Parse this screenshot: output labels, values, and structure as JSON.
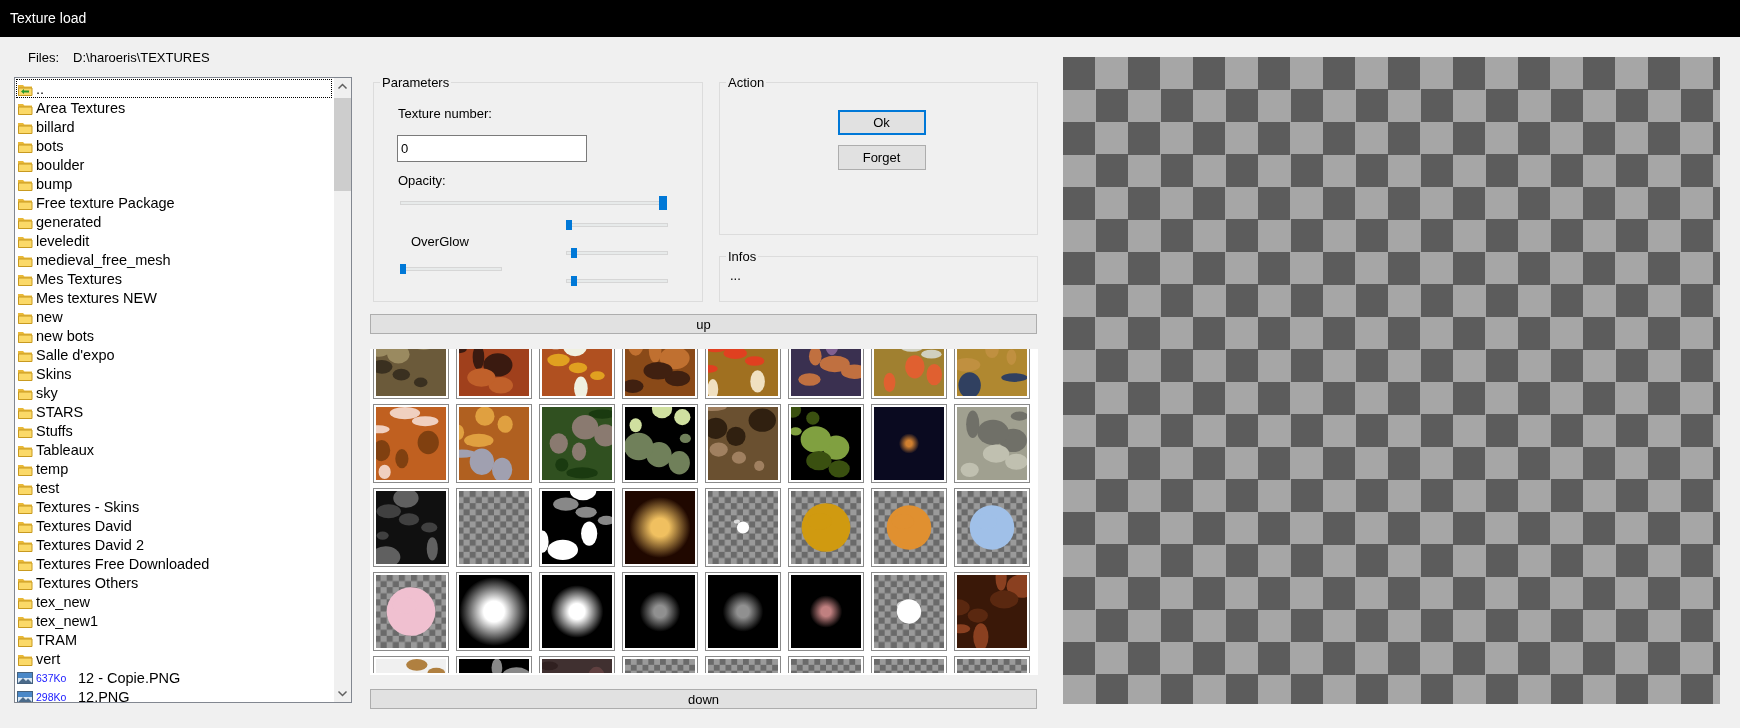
{
  "window": {
    "title": "Texture load"
  },
  "files": {
    "label": "Files:",
    "path": "D:\\haroeris\\TEXTURES",
    "items": [
      {
        "kind": "parent",
        "name": "..",
        "selected": true
      },
      {
        "kind": "folder",
        "name": "Area Textures",
        "selected": false
      },
      {
        "kind": "folder",
        "name": "billard",
        "selected": false
      },
      {
        "kind": "folder",
        "name": "bots",
        "selected": false
      },
      {
        "kind": "folder",
        "name": "boulder",
        "selected": false
      },
      {
        "kind": "folder",
        "name": "bump",
        "selected": false
      },
      {
        "kind": "folder",
        "name": "Free texture Package",
        "selected": false
      },
      {
        "kind": "folder",
        "name": "generated",
        "selected": false
      },
      {
        "kind": "folder",
        "name": "leveledit",
        "selected": false
      },
      {
        "kind": "folder",
        "name": "medieval_free_mesh",
        "selected": false
      },
      {
        "kind": "folder",
        "name": "Mes Textures",
        "selected": false
      },
      {
        "kind": "folder",
        "name": "Mes textures NEW",
        "selected": false
      },
      {
        "kind": "folder",
        "name": "new",
        "selected": false
      },
      {
        "kind": "folder",
        "name": "new bots",
        "selected": false
      },
      {
        "kind": "folder",
        "name": "Salle d'expo",
        "selected": false
      },
      {
        "kind": "folder",
        "name": "Skins",
        "selected": false
      },
      {
        "kind": "folder",
        "name": "sky",
        "selected": false
      },
      {
        "kind": "folder",
        "name": "STARS",
        "selected": false
      },
      {
        "kind": "folder",
        "name": "Stuffs",
        "selected": false
      },
      {
        "kind": "folder",
        "name": "Tableaux",
        "selected": false
      },
      {
        "kind": "folder",
        "name": "temp",
        "selected": false
      },
      {
        "kind": "folder",
        "name": "test",
        "selected": false
      },
      {
        "kind": "folder",
        "name": "Textures - Skins",
        "selected": false
      },
      {
        "kind": "folder",
        "name": "Textures David",
        "selected": false
      },
      {
        "kind": "folder",
        "name": "Textures David 2",
        "selected": false
      },
      {
        "kind": "folder",
        "name": "Textures Free Downloaded",
        "selected": false
      },
      {
        "kind": "folder",
        "name": "Textures Others",
        "selected": false
      },
      {
        "kind": "folder",
        "name": "tex_new",
        "selected": false
      },
      {
        "kind": "folder",
        "name": "tex_new1",
        "selected": false
      },
      {
        "kind": "folder",
        "name": "TRAM",
        "selected": false
      },
      {
        "kind": "folder",
        "name": "vert",
        "selected": false
      },
      {
        "kind": "file",
        "size": "637Ko",
        "name": "12 - Copie.PNG",
        "selected": false
      },
      {
        "kind": "file",
        "size": "298Ko",
        "name": "12.PNG",
        "selected": false
      }
    ]
  },
  "parameters": {
    "title": "Parameters",
    "texture_number_label": "Texture number:",
    "texture_number": "0",
    "opacity": {
      "label": "Opacity:",
      "level": 1
    },
    "overglow": {
      "label": "OverGlow",
      "level": 0
    },
    "sliders": [
      {
        "level": 0
      },
      {
        "level": 0.05
      },
      {
        "level": 0.05
      }
    ]
  },
  "action": {
    "title": "Action",
    "buttons": [
      {
        "label": "Ok",
        "default": true
      },
      {
        "label": "Forget",
        "default": false
      }
    ]
  },
  "infos": {
    "title": "Infos",
    "text": "..."
  },
  "up_button": {
    "label": "up"
  },
  "down_button": {
    "label": "down"
  }
}
